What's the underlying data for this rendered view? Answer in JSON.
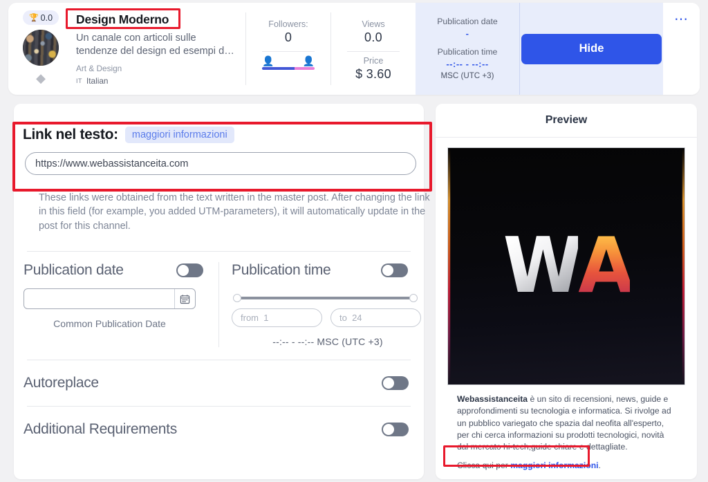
{
  "header": {
    "channel": {
      "rating_icon": "trophy-icon",
      "rating": "0.0",
      "gem_icon": "diamond-icon",
      "title": "Design Moderno",
      "description": "Un canale con articoli sulle tendenze del design ed esempi d…",
      "category": "Art & Design",
      "language_code": "IT",
      "language": "Italian"
    },
    "followers": {
      "label": "Followers:",
      "value": "0",
      "male_icon": "male-person-icon",
      "female_icon": "female-person-icon",
      "male_share_pct": 62,
      "female_share_pct": 38
    },
    "views": {
      "label": "Views",
      "value": "0.0"
    },
    "price": {
      "label": "Price",
      "value": "$ 3.60"
    },
    "publication": {
      "date_label": "Publication date",
      "date_value": "-",
      "time_label": "Publication time",
      "time_value": "--:-- - --:--",
      "timezone": "MSC (UTC +3)"
    },
    "hide_button": "Hide",
    "more_menu_icon": "ellipsis-icon"
  },
  "link_section": {
    "title": "Link nel testo:",
    "chip": "maggiori informazioni",
    "url_value": "https://www.webassistanceita.com",
    "note": "These links were obtained from the text written in the master post. After changing the link in this field (for example, you added UTM-parameters), it will automatically update in the post for this channel."
  },
  "publication_date": {
    "title": "Publication date",
    "toggle_state": "off",
    "input_value": "",
    "calendar_icon": "calendar-icon",
    "caption": "Common Publication Date"
  },
  "publication_time": {
    "title": "Publication time",
    "toggle_state": "off",
    "from_placeholder": "from  1",
    "to_placeholder": "to  24",
    "range_text": "--:-- - --:--  MSC (UTC +3)",
    "slider_min": 1,
    "slider_max": 24
  },
  "autoreplace": {
    "label": "Autoreplace",
    "toggle_state": "off"
  },
  "additional_requirements": {
    "label": "Additional Requirements",
    "toggle_state": "off"
  },
  "preview": {
    "title": "Preview",
    "image_alt": "WA logo on black background",
    "logo_w": "W",
    "logo_a": "A",
    "body_bold": "Webassistanceita",
    "body_text": " è un sito di recensioni, news, guide e approfondimenti su tecnologia e informatica. Si rivolge ad un pubblico variegato che spazia dal neofita all'esperto, per chi cerca informazioni su prodotti tecnologici, novità dal mercato hi-tech,guide chiare e dettagliate.",
    "cta_prefix": "Clicca qui per ",
    "cta_link": "maggiori informazioni",
    "cta_suffix": "."
  },
  "colors": {
    "accent_blue": "#2f55e8",
    "highlight_red": "#e8192c",
    "page_bg": "#f1f1f3",
    "toggle_off": "#6f7787",
    "pub_panel_bg": "#e8edfb"
  }
}
